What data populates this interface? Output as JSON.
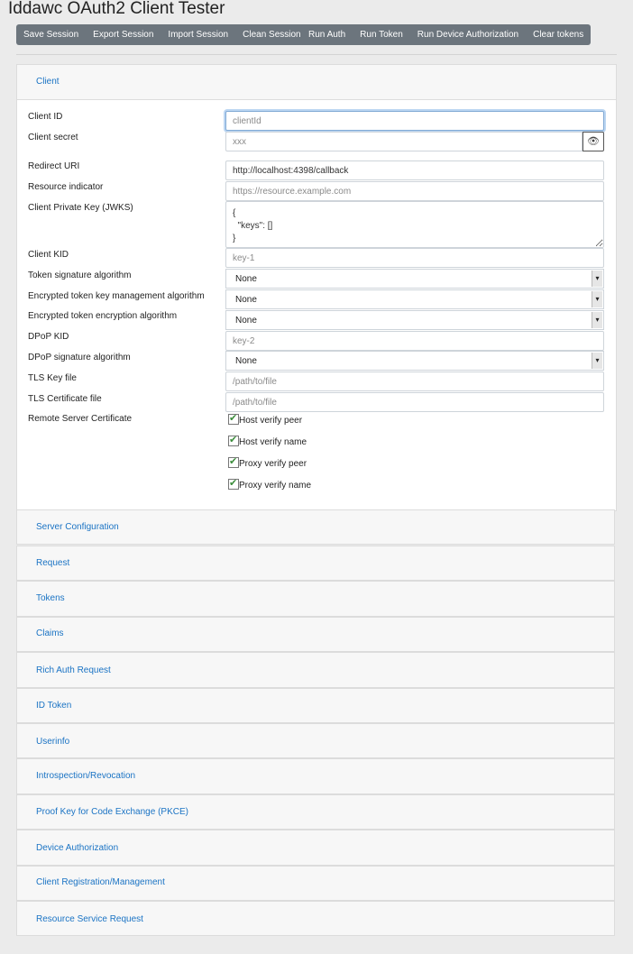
{
  "app": {
    "title": "Iddawc OAuth2 Client Tester"
  },
  "toolbar": {
    "session": [
      "Save Session",
      "Export Session",
      "Import Session",
      "Clean Session"
    ],
    "run": [
      "Run Auth",
      "Run Token",
      "Run Device Authorization",
      "Clear tokens"
    ]
  },
  "client_panel": {
    "title": "Client",
    "client_id": {
      "label": "Client ID",
      "placeholder": "clientId",
      "value": ""
    },
    "client_secret": {
      "label": "Client secret",
      "placeholder": "xxx",
      "toggle_icon": "eye-icon"
    },
    "redirect_uri": {
      "label": "Redirect URI",
      "value": "http://localhost:4398/callback"
    },
    "resource_indicator": {
      "label": "Resource indicator",
      "placeholder": "https://resource.example.com"
    },
    "private_key": {
      "label": "Client Private Key (JWKS)",
      "value": "{\n  \"keys\": []\n}"
    },
    "client_kid": {
      "label": "Client KID",
      "placeholder": "key-1"
    },
    "token_sig_alg": {
      "label": "Token signature algorithm",
      "value": "None"
    },
    "enc_key_mgmt_alg": {
      "label": "Encrypted token key management algorithm",
      "value": "None"
    },
    "enc_token_enc_alg": {
      "label": "Encrypted token encryption algorithm",
      "value": "None"
    },
    "dpop_kid": {
      "label": "DPoP KID",
      "placeholder": "key-2"
    },
    "dpop_sig_alg": {
      "label": "DPoP signature algorithm",
      "value": "None"
    },
    "tls_key": {
      "label": "TLS Key file",
      "placeholder": "/path/to/file"
    },
    "tls_cert": {
      "label": "TLS Certificate file",
      "placeholder": "/path/to/file"
    },
    "remote_cert": {
      "label": "Remote Server Certificate",
      "options": [
        {
          "label": "Host verify peer",
          "checked": true
        },
        {
          "label": "Host verify name",
          "checked": true
        },
        {
          "label": "Proxy verify peer",
          "checked": true
        },
        {
          "label": "Proxy verify name",
          "checked": true
        }
      ]
    }
  },
  "sections": [
    "Server Configuration",
    "Request",
    "Tokens",
    "Claims",
    "Rich Auth Request",
    "ID Token",
    "Userinfo",
    "Introspection/Revocation",
    "Proof Key for Code Exchange (PKCE)",
    "Device Authorization",
    "Client Registration/Management",
    "Resource Service Request"
  ],
  "colors": {
    "button_bg": "#6c757d",
    "link": "#1a73c4",
    "page_bg": "#ebebeb"
  }
}
